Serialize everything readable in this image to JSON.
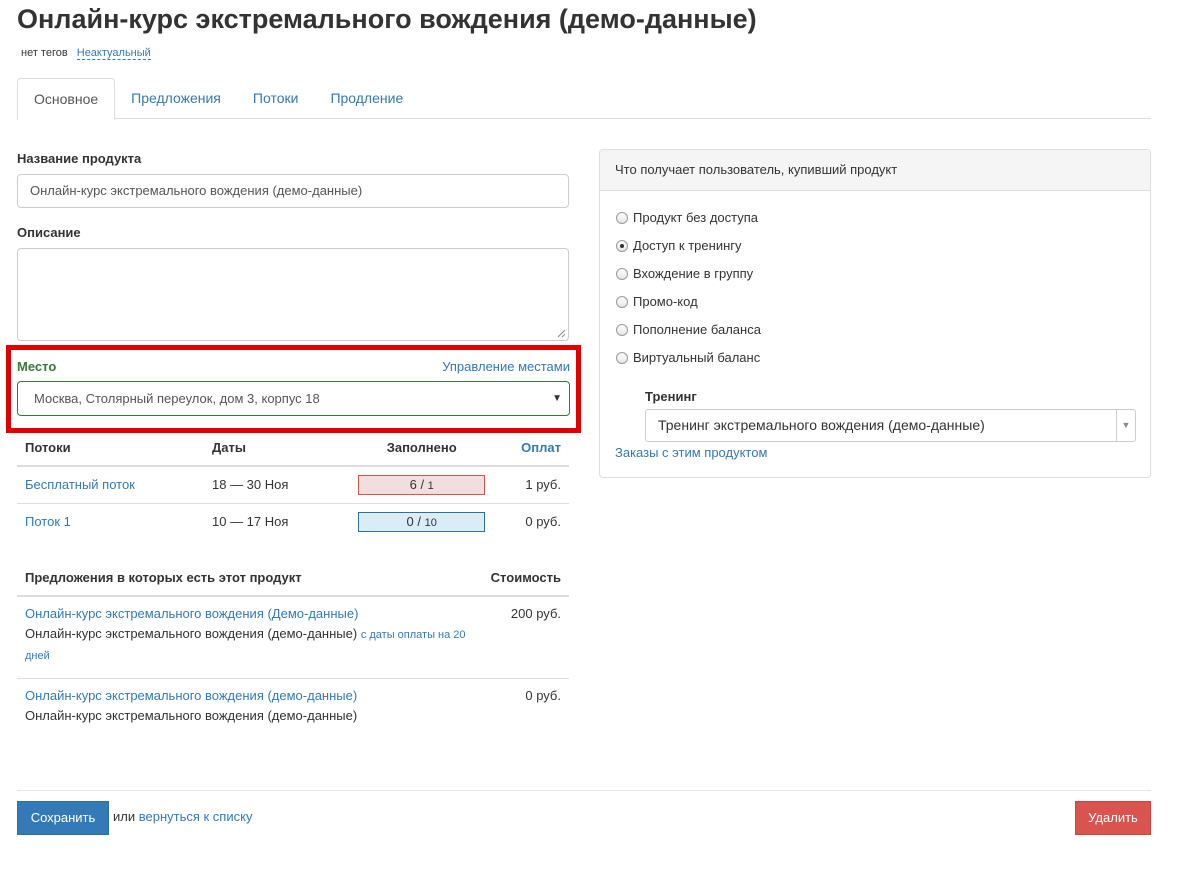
{
  "header": {
    "title": "Онлайн-курс экстремального вождения (демо-данные)",
    "tags": "нет тегов",
    "status": "Неактуальный"
  },
  "tabs": [
    {
      "label": "Основное",
      "active": true
    },
    {
      "label": "Предложения"
    },
    {
      "label": "Потоки"
    },
    {
      "label": "Продление"
    }
  ],
  "form": {
    "name_label": "Название продукта",
    "name_value": "Онлайн-курс экстремального вождения (демо-данные)",
    "description_label": "Описание",
    "description_value": "",
    "place_label": "Место",
    "place_manage": "Управление местами",
    "place_value": "Москва, Столярный переулок, дом 3, корпус 18"
  },
  "flows": {
    "headers": {
      "name": "Потоки",
      "dates": "Даты",
      "filled": "Заполнено",
      "pay": "Оплат"
    },
    "rows": [
      {
        "name": "Бесплатный поток",
        "dates": "18 — 30 Ноя",
        "filled": "6",
        "capacity": "1",
        "pay": "1 руб.",
        "fill_color": "#f2dede"
      },
      {
        "name": "Поток 1",
        "dates": "10 — 17 Ноя",
        "filled": "0",
        "capacity": "10",
        "pay": "0 руб.",
        "fill_color": "#d9edf7"
      }
    ]
  },
  "offers": {
    "headers": {
      "title": "Предложения в которых есть этот продукт",
      "price": "Стоимость"
    },
    "rows": [
      {
        "link": "Онлайн-курс экстремального вождения (Демо-данные)",
        "product": "Онлайн-курс экстремального вождения (демо-данные)",
        "extra": "с даты оплаты на 20 дней",
        "price": "200 руб."
      },
      {
        "link": "Онлайн-курс экстремального вождения (демо-данные)",
        "product": "Онлайн-курс экстремального вождения (демо-данные)",
        "extra": "",
        "price": "0 руб."
      }
    ]
  },
  "panel": {
    "heading": "Что получает пользователь, купивший продукт",
    "options": [
      {
        "label": "Продукт без доступа",
        "checked": false
      },
      {
        "label": "Доступ к тренингу",
        "checked": true
      },
      {
        "label": "Вхождение в группу",
        "checked": false
      },
      {
        "label": "Промо-код",
        "checked": false
      },
      {
        "label": "Пополнение баланса",
        "checked": false
      },
      {
        "label": "Виртуальный баланс",
        "checked": false
      }
    ],
    "training_label": "Тренинг",
    "training_value": "Тренинг экстремального вождения (демо-данные)",
    "orders_link": "Заказы с этим продуктом"
  },
  "footer": {
    "save_label": "Сохранить",
    "or_text": "или",
    "back_link": "вернуться к списку",
    "delete_label": "Удалить"
  },
  "colors": {
    "accent": "#337ab7",
    "danger": "#d9534f",
    "highlight_border": "#e00000",
    "success_text": "#3c763d"
  }
}
